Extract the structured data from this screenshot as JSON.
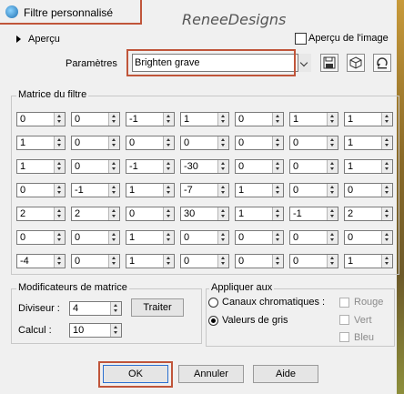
{
  "window": {
    "title": "Filtre personnalisé",
    "watermark": "ReneeDesigns"
  },
  "apercu": {
    "label": "Aperçu",
    "image_label": "Aperçu de l'image"
  },
  "parametres": {
    "label": "Paramètres",
    "value": "Brighten grave"
  },
  "matrix": {
    "label": "Matrice du filtre",
    "rows": [
      [
        "0",
        "0",
        "-1",
        "1",
        "0",
        "1",
        "1"
      ],
      [
        "1",
        "0",
        "0",
        "0",
        "0",
        "0",
        "1"
      ],
      [
        "1",
        "0",
        "-1",
        "-30",
        "0",
        "0",
        "1"
      ],
      [
        "0",
        "-1",
        "1",
        "-7",
        "1",
        "0",
        "0"
      ],
      [
        "2",
        "2",
        "0",
        "30",
        "1",
        "-1",
        "2"
      ],
      [
        "0",
        "0",
        "1",
        "0",
        "0",
        "0",
        "0"
      ],
      [
        "-4",
        "0",
        "1",
        "0",
        "0",
        "0",
        "1"
      ]
    ]
  },
  "modifiers": {
    "label": "Modificateurs de matrice",
    "diviseur_label": "Diviseur :",
    "diviseur_value": "4",
    "calcul_label": "Calcul :",
    "calcul_value": "10",
    "traiter_label": "Traiter"
  },
  "apply": {
    "label": "Appliquer aux",
    "canaux_label": "Canaux chromatiques :",
    "gris_label": "Valeurs de gris",
    "rouge_label": "Rouge",
    "vert_label": "Vert",
    "bleu_label": "Bleu"
  },
  "buttons": {
    "ok": "OK",
    "annuler": "Annuler",
    "aide": "Aide"
  }
}
